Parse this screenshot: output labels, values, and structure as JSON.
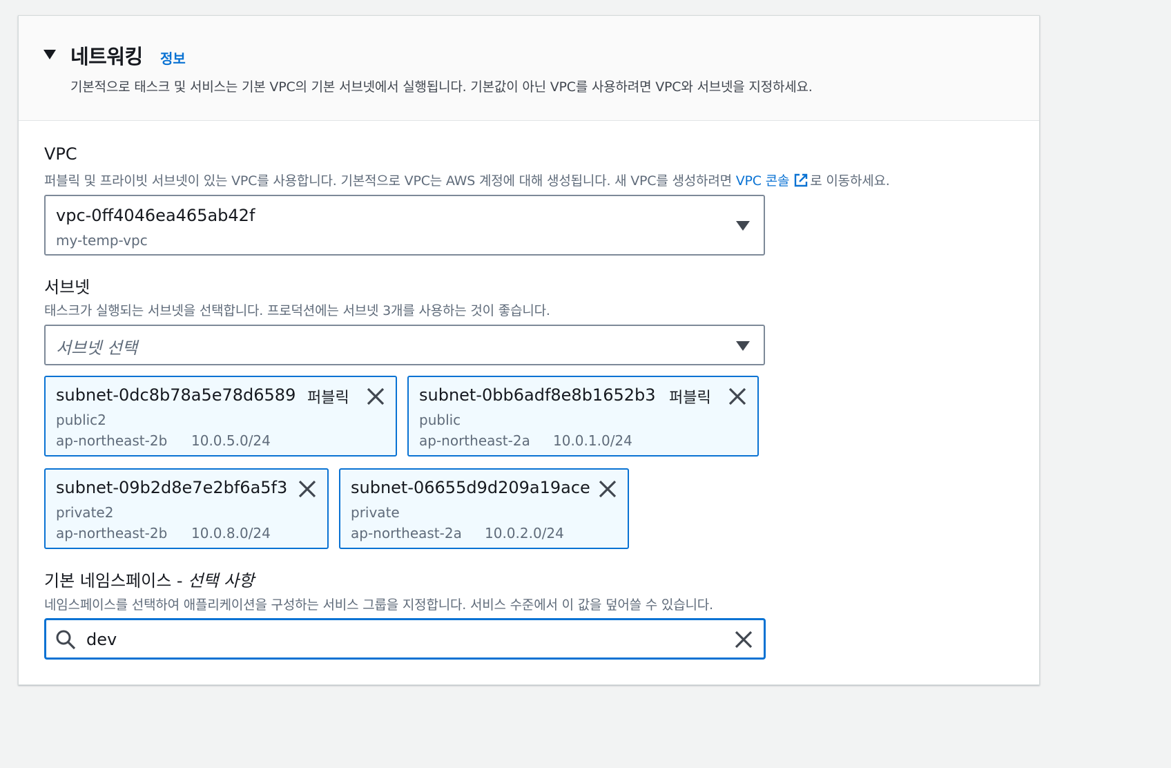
{
  "section": {
    "title": "네트워킹",
    "info_link": "정보",
    "description": "기본적으로 태스크 및 서비스는 기본 VPC의 기본 서브넷에서 실행됩니다. 기본값이 아닌 VPC를 사용하려면 VPC와 서브넷을 지정하세요."
  },
  "vpc": {
    "label": "VPC",
    "description_before": "퍼블릭 및 프라이빗 서브넷이 있는 VPC를 사용합니다. 기본적으로 VPC는 AWS 계정에 대해 생성됩니다. 새 VPC를 생성하려면 ",
    "console_link": "VPC 콘솔",
    "description_after": "로 이동하세요.",
    "selected_id": "vpc-0ff4046ea465ab42f",
    "selected_name": "my-temp-vpc"
  },
  "subnets": {
    "label": "서브넷",
    "description": "태스크가 실행되는 서브넷을 선택합니다. 프로덕션에는 서브넷 3개를 사용하는 것이 좋습니다.",
    "placeholder": "서브넷 선택",
    "tokens": [
      {
        "id": "subnet-0dc8b78a5e78d6589",
        "tag": "퍼블릭",
        "name": "public2",
        "az": "ap-northeast-2b",
        "cidr": "10.0.5.0/24"
      },
      {
        "id": "subnet-0bb6adf8e8b1652b3",
        "tag": "퍼블릭",
        "name": "public",
        "az": "ap-northeast-2a",
        "cidr": "10.0.1.0/24"
      },
      {
        "id": "subnet-09b2d8e7e2bf6a5f3",
        "tag": "",
        "name": "private2",
        "az": "ap-northeast-2b",
        "cidr": "10.0.8.0/24"
      },
      {
        "id": "subnet-06655d9d209a19ace",
        "tag": "",
        "name": "private",
        "az": "ap-northeast-2a",
        "cidr": "10.0.2.0/24"
      }
    ]
  },
  "namespace": {
    "label": "기본 네임스페이스 - ",
    "label_optional": "선택 사항",
    "description": "네임스페이스를 선택하여 애플리케이션을 구성하는 서비스 그룹을 지정합니다. 서비스 수준에서 이 값을 덮어쓸 수 있습니다.",
    "value": "dev"
  },
  "colors": {
    "accent": "#0972d3",
    "token_bg": "#f1faff",
    "border": "#7d8998"
  }
}
